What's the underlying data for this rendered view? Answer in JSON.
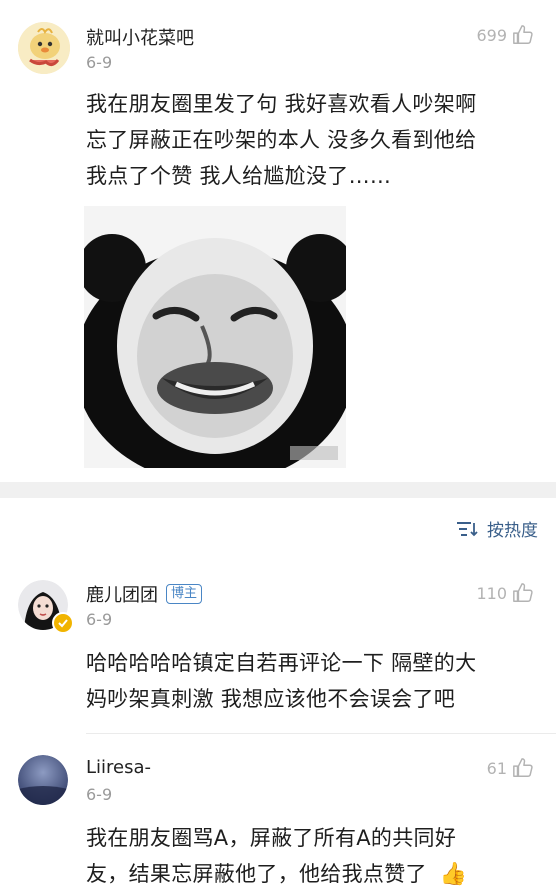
{
  "post": {
    "author": "就叫小花菜吧",
    "date": "6-9",
    "likes": "699",
    "text_lines": [
      "我在朋友圈里发了句 我好喜欢看人吵架啊",
      "忘了屏蔽正在吵架的本人 没多久看到他给",
      "我点了个赞 我人给尴尬没了……"
    ],
    "image_icon": "panda-meme-image"
  },
  "sort": {
    "label": "按热度",
    "icon": "sort-icon"
  },
  "comments": [
    {
      "author": "鹿儿团团",
      "badge": "博主",
      "date": "6-9",
      "likes": "110",
      "text_lines": [
        "哈哈哈哈哈镇定自若再评论一下 隔壁的大",
        "妈吵架真刺激 我想应该他不会误会了吧"
      ]
    },
    {
      "author": "Liiresa-",
      "date": "6-9",
      "likes": "61",
      "text_lines": [
        "我在朋友圈骂A，屏蔽了所有A的共同好",
        "友，结果忘屏蔽他了，他给我点赞了"
      ],
      "emoji": "👍"
    }
  ],
  "colors": {
    "like_gray": "#b3b3b3",
    "badge_blue": "#4a86c5",
    "verified_gold": "#f1b400",
    "sort_blue": "#3a5f8a"
  }
}
